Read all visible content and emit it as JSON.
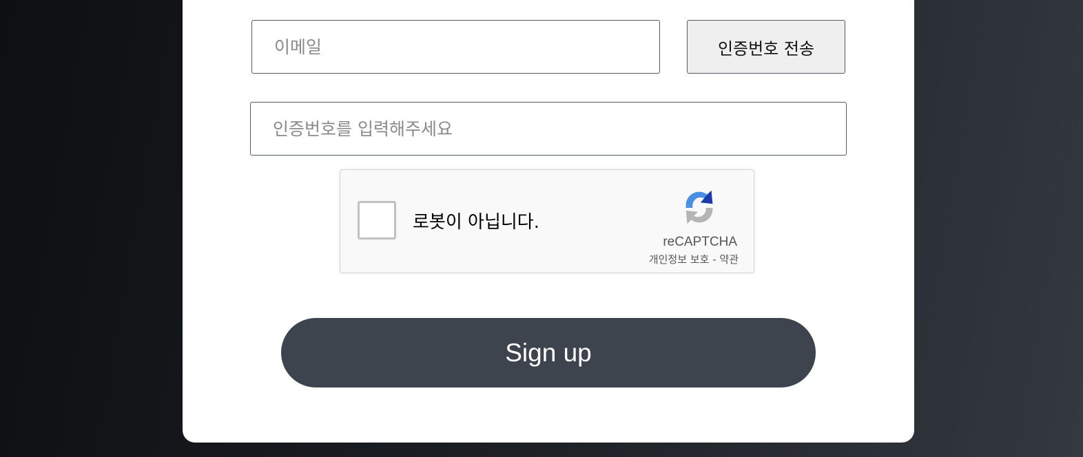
{
  "form": {
    "email_placeholder": "이메일",
    "email_value": "",
    "send_code_label": "인증번호 전송",
    "code_placeholder": "인증번호를 입력해주세요",
    "code_value": ""
  },
  "recaptcha": {
    "checkbox_label": "로봇이 아닙니다.",
    "checked": false,
    "brand": "reCAPTCHA",
    "privacy_label": "개인정보 보호",
    "separator": "-",
    "terms_label": "약관",
    "logo_icon": "recaptcha-logo-icon"
  },
  "signup": {
    "label": "Sign up",
    "color": "#3e444e"
  },
  "colors": {
    "card_background": "#ffffff",
    "page_background": "#1c1f24"
  }
}
